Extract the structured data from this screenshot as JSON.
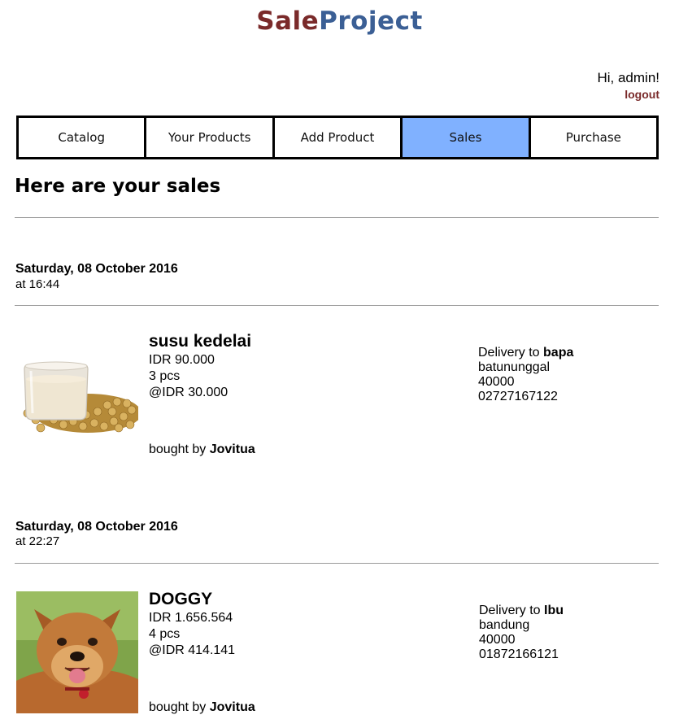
{
  "brand": {
    "part1": "Sale",
    "part2": "Project"
  },
  "user": {
    "greeting": "Hi, admin!",
    "logout": "logout"
  },
  "nav": {
    "tabs": [
      {
        "label": "Catalog"
      },
      {
        "label": "Your Products"
      },
      {
        "label": "Add Product"
      },
      {
        "label": "Sales"
      },
      {
        "label": "Purchase"
      }
    ],
    "active": "Sales"
  },
  "page": {
    "heading": "Here are your sales"
  },
  "sales": [
    {
      "date": "Saturday, 08 October 2016",
      "time": "at 16:44",
      "product_name": "susu kedelai",
      "total": "IDR 90.000",
      "quantity": "3 pcs",
      "unit_price": "@IDR 30.000",
      "bought_by_prefix": "bought by",
      "buyer": "Jovitua",
      "delivery_prefix": "Delivery to",
      "recipient": "bapa",
      "address": "batununggal",
      "postal_code": "40000",
      "phone": "02727167122"
    },
    {
      "date": "Saturday, 08 October 2016",
      "time": "at 22:27",
      "product_name": "DOGGY",
      "total": "IDR 1.656.564",
      "quantity": "4 pcs",
      "unit_price": "@IDR 414.141",
      "bought_by_prefix": "bought by",
      "buyer": "Jovitua",
      "delivery_prefix": "Delivery to",
      "recipient": "Ibu",
      "address": "bandung",
      "postal_code": "40000",
      "phone": "01872166121"
    }
  ],
  "colors": {
    "brand_sale": "#7a2a2a",
    "brand_project": "#3b5f95",
    "active_tab": "#80b1ff",
    "logout": "#7a2a2a"
  }
}
